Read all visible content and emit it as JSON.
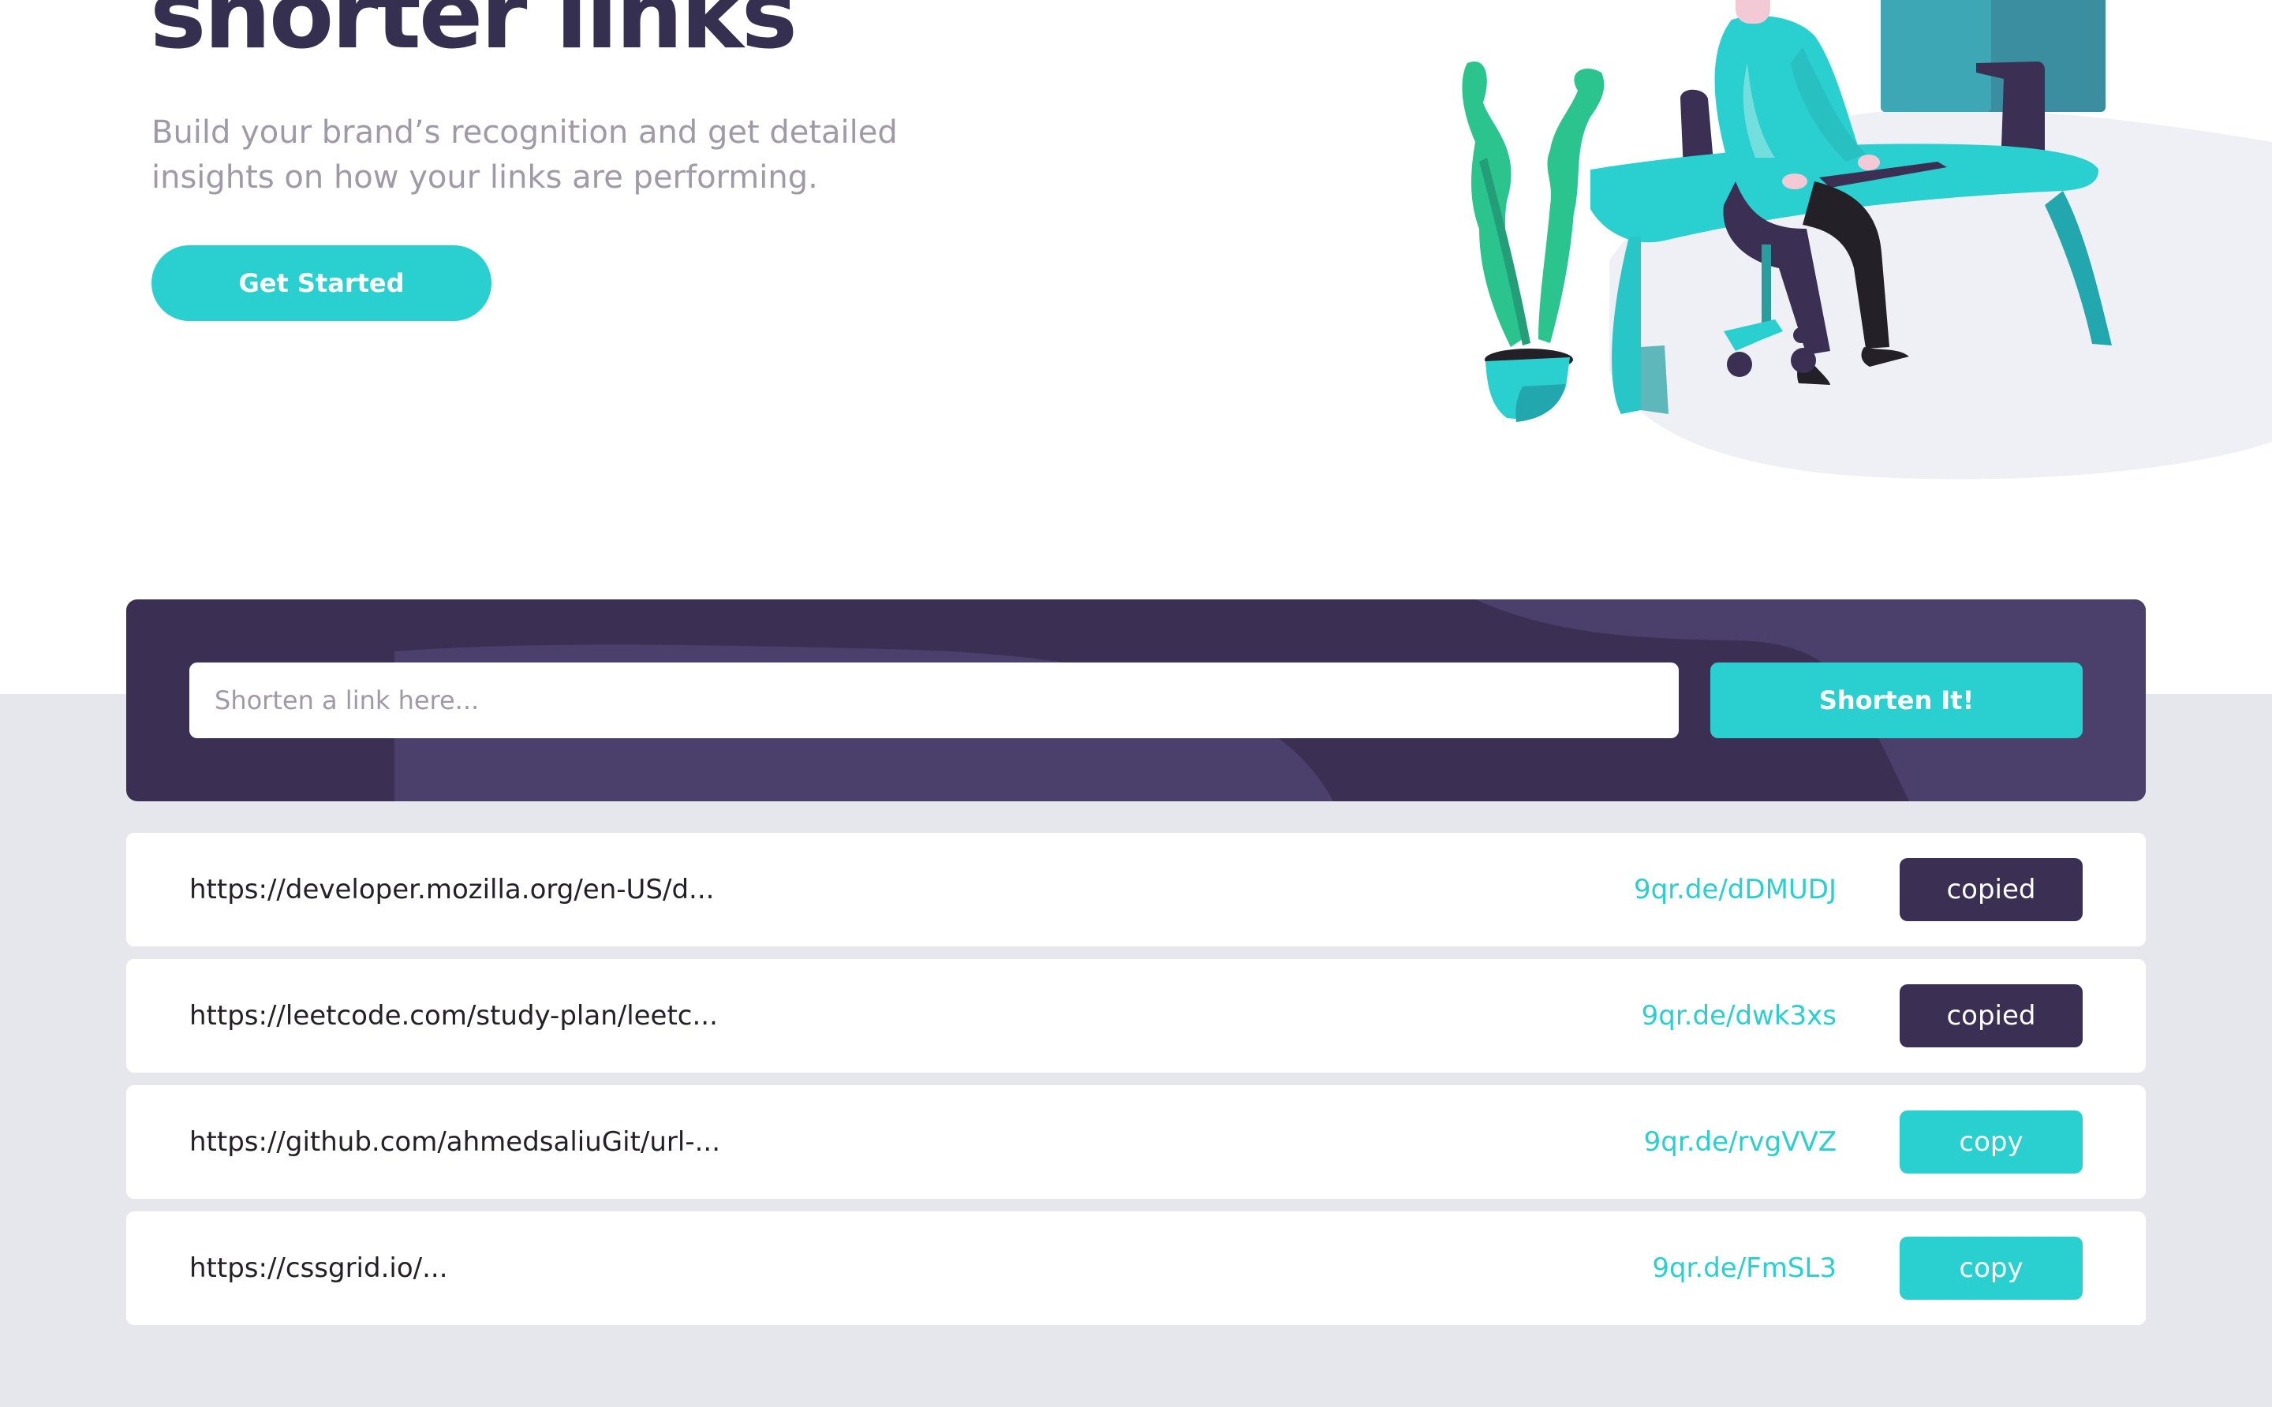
{
  "hero": {
    "title": "shorter links",
    "subtitle": "Build your brand’s recognition and get detailed insights on how your links are performing.",
    "cta_label": "Get Started",
    "illustration": "person-working-at-desk-illustration"
  },
  "shorten": {
    "placeholder": "Shorten a link here...",
    "button_label": "Shorten It!"
  },
  "results": [
    {
      "original": "https://developer.mozilla.org/en-US/d...",
      "short": "9qr.de/dDMUDJ",
      "button": "copied",
      "state": "copied"
    },
    {
      "original": "https://leetcode.com/study-plan/leetc...",
      "short": "9qr.de/dwk3xs",
      "button": "copied",
      "state": "copied"
    },
    {
      "original": "https://github.com/ahmedsaliuGit/url-...",
      "short": "9qr.de/rvgVVZ",
      "button": "copy",
      "state": "copy"
    },
    {
      "original": "https://cssgrid.io/...",
      "short": "9qr.de/FmSL3",
      "button": "copy",
      "state": "copy"
    }
  ],
  "colors": {
    "primary": "#2acfcf",
    "dark_violet": "#3b3054",
    "gray_violet": "#9e9aa8",
    "heading": "#35304f",
    "band_background": "#e6e7ec"
  }
}
